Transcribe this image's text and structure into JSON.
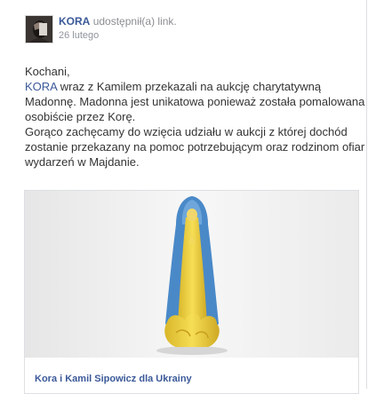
{
  "post": {
    "author": "KORA",
    "action": "udostępnił(a) link.",
    "timestamp": "26 lutego",
    "greeting": "Kochani,",
    "mention": "KORA",
    "line1_rest": " wraz z Kamilem przekazali na aukcję charytatywną Madonnę. Madonna jest unikatowa ponieważ została pomalowana osobiście przez Korę.",
    "line2": "Gorąco zachęcamy do wzięcia udziału w aukcji z której dochód zostanie przekazany na pomoc potrzebującym oraz rodzinom ofiar wydarzeń w Majdanie."
  },
  "attachment": {
    "title": "Kora i Kamil Sipowicz dla Ukrainy"
  },
  "colors": {
    "link": "#3b5998",
    "statue_blue": "#4a89c8",
    "statue_yellow": "#f0d23c"
  }
}
